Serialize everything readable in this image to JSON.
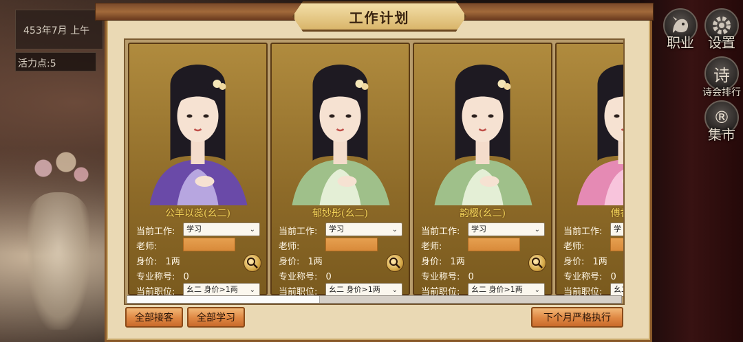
{
  "status": {
    "date": "453年7月  上午",
    "vigor": "活力点:5"
  },
  "side_menu": [
    {
      "label": "职业",
      "icon": "profession-icon"
    },
    {
      "label": "设置",
      "icon": "gear-icon"
    },
    {
      "label": "诗会排行",
      "icon_char": "诗",
      "icon": "poetry-ranking-icon"
    },
    {
      "label": "集市",
      "icon_char": "®",
      "icon": "market-icon"
    }
  ],
  "panel": {
    "title": "工作计划"
  },
  "labels": {
    "current_work": "当前工作:",
    "teacher": "老师:",
    "price": "身价:",
    "title_count": "专业称号:",
    "position": "当前职位:"
  },
  "cards": [
    {
      "name": "公羊以蕊(幺二)",
      "work": "学习",
      "price": "1两",
      "title_count": "0",
      "position": "幺二  身价>1两",
      "outfit": "#6a4aa8",
      "outfit_light": "#b7a6e0"
    },
    {
      "name": "郁妙彤(幺二)",
      "work": "学习",
      "price": "1两",
      "title_count": "0",
      "position": "幺二  身价>1两",
      "outfit": "#9fc08a",
      "outfit_light": "#e4efd6"
    },
    {
      "name": "韵樱(幺二)",
      "work": "学习",
      "price": "1两",
      "title_count": "0",
      "position": "幺二  身价>1两",
      "outfit": "#9fc08a",
      "outfit_light": "#e4efd6"
    },
    {
      "name": "傅香芦",
      "work": "学",
      "price": "1两",
      "title_count": "0",
      "position": "幺二",
      "outfit": "#e58ab4",
      "outfit_light": "#f8c4dc"
    }
  ],
  "scroll": {
    "position_fraction": 0.39
  },
  "buttons": {
    "all_receive": "全部接客",
    "all_study": "全部学习",
    "execute_next_month": "下个月严格执行"
  }
}
